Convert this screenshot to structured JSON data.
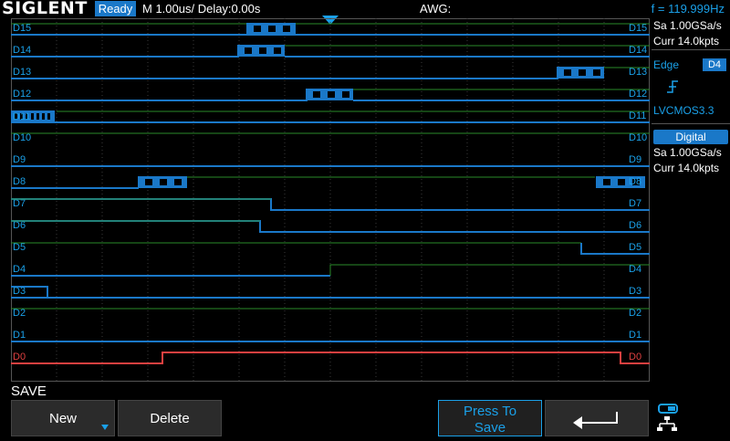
{
  "header": {
    "brand": "SIGLENT",
    "run_state": "Ready",
    "timebase": "M 1.00us/  Delay:0.00s",
    "awg": "AWG:",
    "frequency": "f = 119.999Hz"
  },
  "acquisition": {
    "sample_rate": "Sa 1.00GSa/s",
    "memory": "Curr 14.0kpts"
  },
  "trigger": {
    "type_label": "Edge",
    "source": "D4",
    "slope_icon": "rising-edge-icon",
    "level": "LVCMOS3.3"
  },
  "digital": {
    "header": "Digital",
    "sample_rate": "Sa 1.00GSa/s",
    "memory": "Curr 14.0kpts"
  },
  "channels": {
    "left": [
      "D15",
      "D14",
      "D13",
      "D12",
      "D11",
      "D10",
      "D9",
      "D8",
      "D7",
      "D6",
      "D5",
      "D4",
      "D3",
      "D2",
      "D1",
      "D0"
    ],
    "right": [
      "D15",
      "D14",
      "D13",
      "D12",
      "D11",
      "D10",
      "D9",
      "D8",
      "D7",
      "D6",
      "D5",
      "D4",
      "D3",
      "D2",
      "D1",
      "D0"
    ]
  },
  "menu": {
    "title": "SAVE",
    "new_label": "New",
    "delete_label": "Delete",
    "press_line1": "Press To",
    "press_line2": "Save",
    "back_icon": "return-arrow-icon",
    "network_icon": "network-icon"
  },
  "colors": {
    "accent": "#1aa0e8",
    "trace_blue": "#1a78c8",
    "trace_green": "#2a8a2a",
    "trace_red": "#e04040"
  }
}
